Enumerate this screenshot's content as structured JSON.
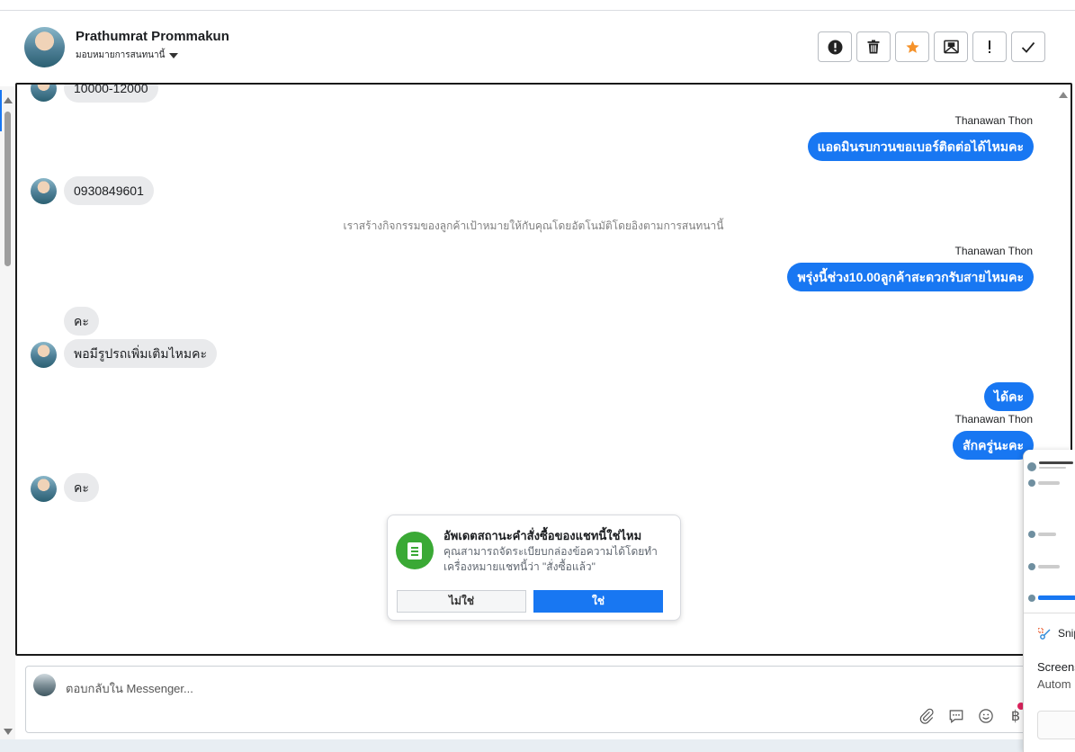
{
  "header": {
    "contact_name": "Prathumrat Prommakun",
    "assign_label": "มอบหมายการสนทนานี้",
    "toolbar": [
      {
        "name": "spam-button",
        "icon": "exclamation-circle-icon",
        "glyph": "●"
      },
      {
        "name": "delete-button",
        "icon": "trash-icon",
        "glyph": "🗑"
      },
      {
        "name": "star-button",
        "icon": "star-icon",
        "glyph": "★"
      },
      {
        "name": "mark-unread-button",
        "icon": "envelope-icon",
        "glyph": "✉"
      },
      {
        "name": "mark-important-button",
        "icon": "exclamation-icon",
        "glyph": "!"
      },
      {
        "name": "mark-done-button",
        "icon": "check-icon",
        "glyph": "✓"
      }
    ]
  },
  "messages": [
    {
      "type": "incoming",
      "text": "10000-12000",
      "avatar": true
    },
    {
      "type": "outgoing",
      "sender": "Thanawan Thon",
      "text": "แอดมินรบกวนขอเบอร์ติดต่อได้ไหมคะ"
    },
    {
      "type": "incoming",
      "text": "0930849601",
      "avatar": true
    },
    {
      "type": "system",
      "text": "เราสร้างกิจกรรมของลูกค้าเป้าหมายให้กับคุณโดยอัตโนมัติโดยอิงตามการสนทนานี้"
    },
    {
      "type": "outgoing",
      "sender": "Thanawan Thon",
      "text": "พรุ่งนี้ช่วง10.00ลูกค้าสะดวกรับสายไหมคะ"
    },
    {
      "type": "incoming",
      "text": "คะ",
      "avatar": false
    },
    {
      "type": "incoming",
      "text": "พอมีรูปรถเพิ่มเติมไหมคะ",
      "avatar": true
    },
    {
      "type": "outgoing",
      "sender": "",
      "text": "ได้คะ"
    },
    {
      "type": "outgoing",
      "sender": "Thanawan Thon",
      "text": "สักครู่นะคะ"
    },
    {
      "type": "incoming",
      "text": "คะ",
      "avatar": true
    }
  ],
  "order_prompt": {
    "title": "อัพเดตสถานะคำสั่งซื้อของแชทนี้ใช่ไหม",
    "body": "คุณสามารถจัดระเบียบกล่องข้อความได้โดยทำเครื่องหมายแชทนี้ว่า \"สั่งซื้อแล้ว\"",
    "no_label": "ไม่ใช่",
    "yes_label": "ใช่",
    "icon": "receipt-icon",
    "accent_color": "#3aa935"
  },
  "composer": {
    "placeholder": "ตอบกลับใน Messenger...",
    "icons": [
      "paperclip-icon",
      "saved-reply-icon",
      "emoji-icon",
      "baht-icon"
    ]
  },
  "snipping_notification": {
    "app_name": "Snip",
    "line1": "Screens",
    "line2": "Autom"
  },
  "colors": {
    "brand_blue": "#1877f2",
    "incoming_bubble": "#e9eaec"
  }
}
